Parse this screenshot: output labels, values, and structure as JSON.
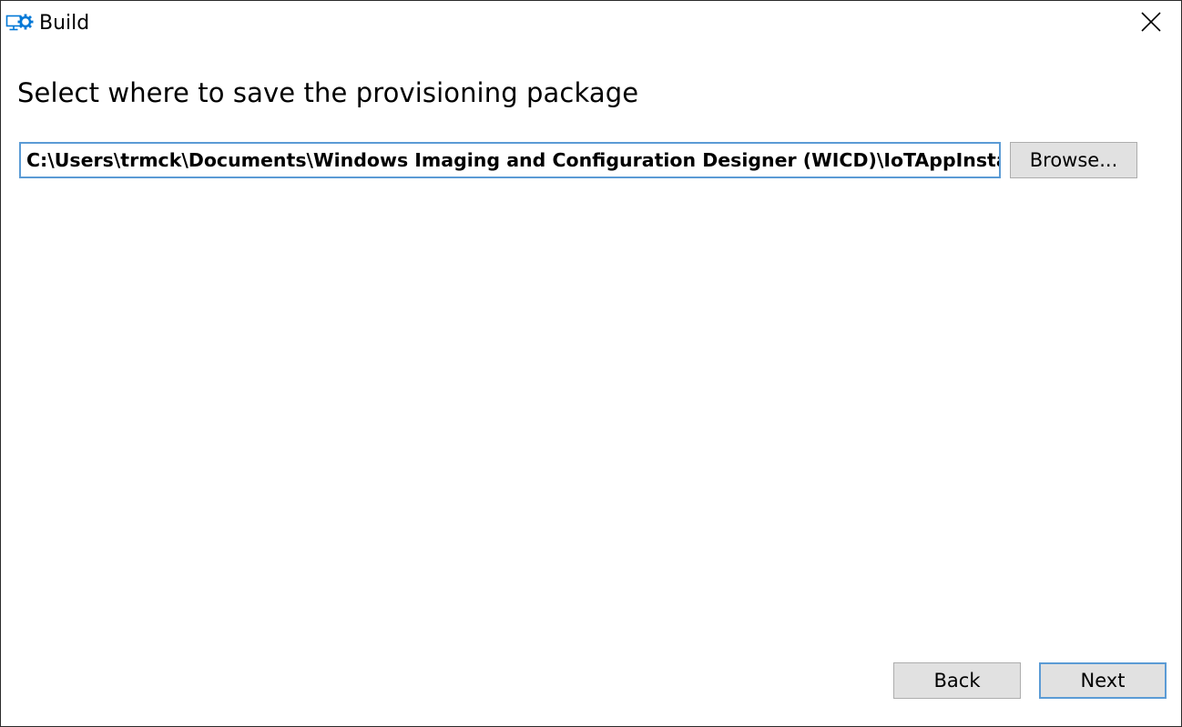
{
  "window": {
    "title": "Build",
    "icon": "monitor-gear-icon",
    "close_icon": "close-icon"
  },
  "main": {
    "heading": "Select where to save the provisioning package",
    "path_value": "C:\\Users\\trmck\\Documents\\Windows Imaging and Configuration Designer (WICD)\\IoTAppInstall\\IoTAppInstall.ppkg",
    "browse_label": "Browse..."
  },
  "footer": {
    "back_label": "Back",
    "next_label": "Next"
  },
  "colors": {
    "accent": "#0078d7",
    "focus_border": "#5b9bd5",
    "button_face": "#e1e1e1",
    "button_border": "#adadad"
  }
}
